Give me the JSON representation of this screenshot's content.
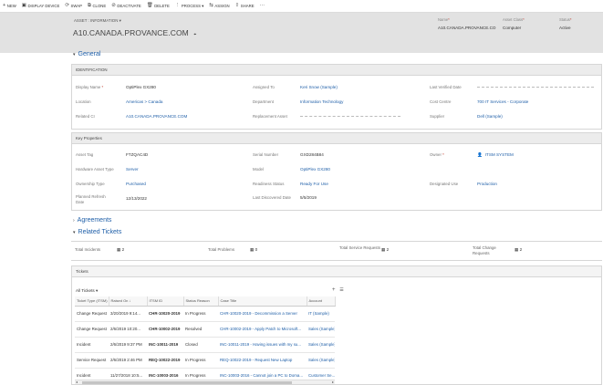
{
  "toolbar": {
    "items": [
      {
        "icon": "+",
        "label": "NEW"
      },
      {
        "icon": "▣",
        "label": "DISPLAY DEVICE"
      },
      {
        "icon": "⟳",
        "label": "SWAP"
      },
      {
        "icon": "⧉",
        "label": "CLONE"
      },
      {
        "icon": "⊘",
        "label": "DEACTIVATE"
      },
      {
        "icon": "🗑",
        "label": "DELETE"
      },
      {
        "icon": "⋮",
        "label": "PROCESS ▾"
      },
      {
        "icon": "⇆",
        "label": "ASSIGN"
      },
      {
        "icon": "⇪",
        "label": "SHARE"
      },
      {
        "icon": "···",
        "label": ""
      }
    ]
  },
  "header": {
    "entity": "ASSET : INFORMATION ▾",
    "title": "A10.CANADA.PROVANCE.COM",
    "fields": [
      {
        "label": "Name",
        "value": "A10.CANADA.PROVANCE.CO"
      },
      {
        "label": "Asset Class",
        "value": "Computer"
      },
      {
        "label": "Status",
        "value": "Active"
      }
    ]
  },
  "sections": {
    "general": "General",
    "agreements": "Agreements",
    "related": "Related Tickets"
  },
  "identification": {
    "title": "IDENTIFICATION",
    "display_name_label": "Display Name",
    "display_name": "OptiPlex GX280",
    "location_label": "Location",
    "location": "Americas > Canada",
    "related_ci_label": "Related CI",
    "related_ci": "A10.CANADA.PROVANCE.COM",
    "assigned_to_label": "Assigned To",
    "assigned_to": "Keri Snow (Sample)",
    "department_label": "Department",
    "department": "Information Technology",
    "replacement_label": "Replacement Asset",
    "last_verified_label": "Last Verified Date",
    "cost_centre_label": "Cost Centre",
    "cost_centre": "700 IT Services - Corporate",
    "supplier_label": "Supplier",
    "supplier": "Dell (Sample)"
  },
  "key_props": {
    "title": "Key Properties",
    "asset_tag_label": "Asset Tag",
    "asset_tag": "FTZQAC4D",
    "hw_type_label": "Hardware Asset Type",
    "hw_type": "Server",
    "ownership_label": "Ownership Type",
    "ownership": "Purchased",
    "refresh_label": "Planned Refresh Date",
    "refresh": "12/13/2022",
    "serial_label": "Serial Number",
    "serial": "GXD284B84",
    "model_label": "Model",
    "model": "OptiPlex GX280",
    "readiness_label": "Readiness Status",
    "readiness": "Ready For Use",
    "discovered_label": "Last Discovered Date",
    "discovered": "5/5/2019",
    "owner_label": "Owner",
    "owner": "ITSM SYSTEM",
    "designated_label": "Designated Use",
    "designated": "Production"
  },
  "related_counts": [
    {
      "label": "Total Incidents",
      "value": "2"
    },
    {
      "label": "Total Problems",
      "value": "0"
    },
    {
      "label": "Total Service Requests",
      "value": "2"
    },
    {
      "label": "Total Change Requests",
      "value": "2"
    }
  ],
  "tickets": {
    "title": "Tickets",
    "view": "All Tickets",
    "columns": [
      "Ticket Type (ITSM)",
      "Raised On ↓",
      "ITSM ID",
      "Status Reason",
      "Case Title",
      "Account"
    ],
    "rows": [
      [
        "Change Request",
        "3/20/2019 9:14...",
        "CHR-10020-2019",
        "In Progress",
        "CHR-10020-2019 - Decommission a Server",
        "IT (Sample)"
      ],
      [
        "Change Request",
        "2/6/2019 10:20...",
        "CHR-10002-2019",
        "Resolved",
        "CHR-10002-2019 - Apply Patch to Microsoft...",
        "Sales (Sample)"
      ],
      [
        "Incident",
        "2/6/2019 9:37 PM",
        "INC-10011-2019",
        "Closed",
        "INC-10011-2019 - Having issues with my su...",
        "Sales (Sample)"
      ],
      [
        "Service Request",
        "2/6/2019 2:46 PM",
        "REQ-10022-2019",
        "In Progress",
        "REQ-10022-2019 - Request New Laptop",
        "Sales (Sample)"
      ],
      [
        "Incident",
        "11/27/2018 10:5...",
        "INC-10003-2016",
        "In Progress",
        "INC-10003-2016 - Cannot join a PC to Doma...",
        "Customer Se..."
      ]
    ]
  }
}
